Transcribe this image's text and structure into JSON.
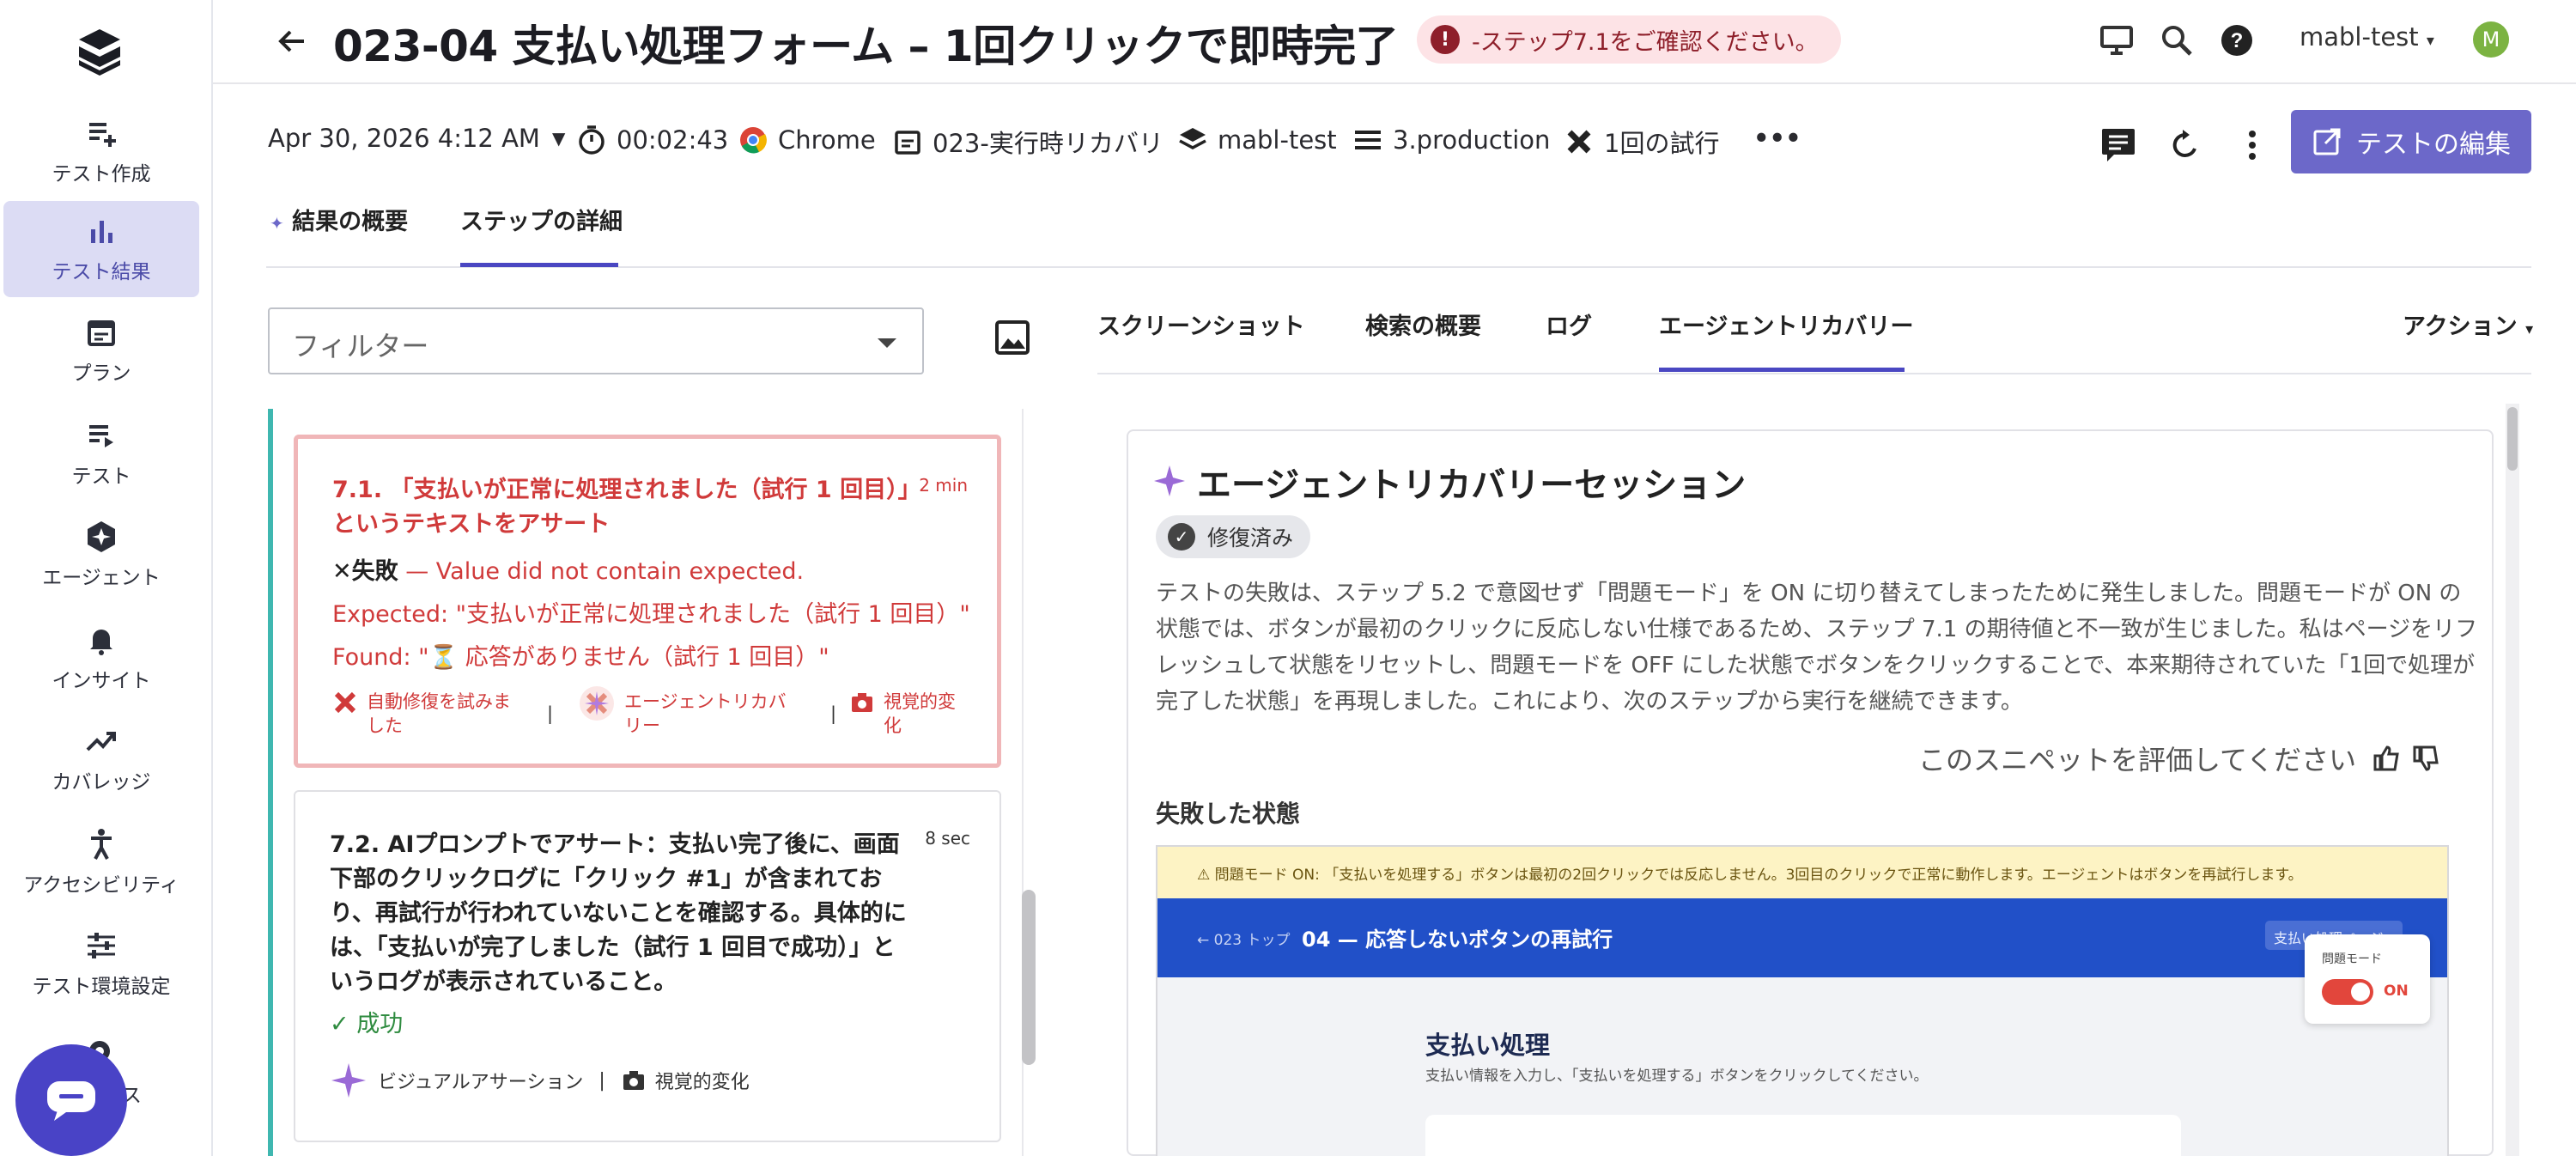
{
  "sidebar": {
    "items": [
      {
        "label": "テスト作成",
        "icon": "create-test-icon"
      },
      {
        "label": "テスト結果",
        "icon": "bar-chart-icon",
        "active": true
      },
      {
        "label": "プラン",
        "icon": "calendar-icon"
      },
      {
        "label": "テスト",
        "icon": "list-play-icon"
      },
      {
        "label": "エージェント",
        "icon": "agent-sparkle-icon"
      },
      {
        "label": "インサイト",
        "icon": "bell-icon"
      },
      {
        "label": "カバレッジ",
        "icon": "trending-up-icon"
      },
      {
        "label": "アクセシビリティ",
        "icon": "accessibility-icon"
      },
      {
        "label": "テスト環境設定",
        "icon": "sliders-icon"
      },
      {
        "label": "ワークスペース",
        "icon": "gear-icon"
      }
    ],
    "chat_visible_label": "ース"
  },
  "header": {
    "title": "023-04 支払い処理フォーム – 1回クリックで即時完了",
    "alert": "-ステップ7.1をご確認ください。",
    "user": "mabl-test",
    "avatar_initial": "M"
  },
  "meta": {
    "date": "Apr 30, 2026 4:12 AM",
    "duration": "00:02:43",
    "browser": "Chrome",
    "plan": "023-実行時リカバリ",
    "workspace": "mabl-test",
    "environment": "3.production",
    "attempts": "1回の試行",
    "more": "•••"
  },
  "edit_button": "テストの編集",
  "tabs": {
    "summary": "結果の概要",
    "steps": "ステップの詳細"
  },
  "filter": {
    "placeholder": "フィルター"
  },
  "steps": [
    {
      "title": "7.1. 「支払いが正常に処理されました（試行 1 回目）」というテキストをアサート",
      "duration": "2 min",
      "status": "失敗",
      "message": "— Value did not contain expected.",
      "expected": "Expected: \"支払いが正常に処理されました（試行 1 回目）\"",
      "found": "Found: \"⏳ 応答がありません（試行 1 回目）\"",
      "badges": [
        "自動修復を試みました",
        "エージェントリカバリー",
        "視覚的変化"
      ]
    },
    {
      "title": "7.2. AIプロンプトでアサート：支払い完了後に、画面下部のクリックログに「クリック #1」が含まれており、再試行が行われていないことを確認する。具体的には、「支払いが完了しました（試行 1 回目で成功）」というログが表示されていること。",
      "duration": "8 sec",
      "status": "成功",
      "badges": [
        "ビジュアルアサーション",
        "視覚的変化"
      ]
    }
  ],
  "detail_tabs": {
    "screenshot": "スクリーンショット",
    "search": "検索の概要",
    "logs": "ログ",
    "agent": "エージェントリカバリー",
    "actions": "アクション"
  },
  "session": {
    "title": "エージェントリカバリーセッション",
    "status": "修復済み",
    "description": "テストの失敗は、ステップ 5.2 で意図せず「問題モード」を ON に切り替えてしまったために発生しました。問題モードが ON の状態では、ボタンが最初のクリックに反応しない仕様であるため、ステップ 7.1 の期待値と不一致が生じました。私はページをリフレッシュして状態をリセットし、問題モードを OFF にした状態でボタンをクリックすることで、本来期待されていた「1回で処理が完了した状態」を再現しました。これにより、次のステップから実行を継続できます。",
    "rate": "このスニペットを評価してください",
    "failed_state": "失敗した状態"
  },
  "shot": {
    "warning": "⚠ 問題モード ON: 「支払いを処理する」ボタンは最初の2回クリックでは反応しません。3回目のクリックで正常に動作します。エージェントはボタンを再試行します。",
    "back": "← 023 トップ",
    "heading": "04 — 応答しないボタンの再試行",
    "btn": "支払い処理ページ",
    "popup_label": "問題モード",
    "popup_on": "ON",
    "pay_title": "支払い処理",
    "pay_sub": "支払い情報を入力し、「支払いを処理する」ボタンをクリックしてください。"
  },
  "colors": {
    "accent": "#4a47c2",
    "error": "#d03a3a",
    "success": "#2e8b3f",
    "primary_button": "#6c68c9"
  }
}
